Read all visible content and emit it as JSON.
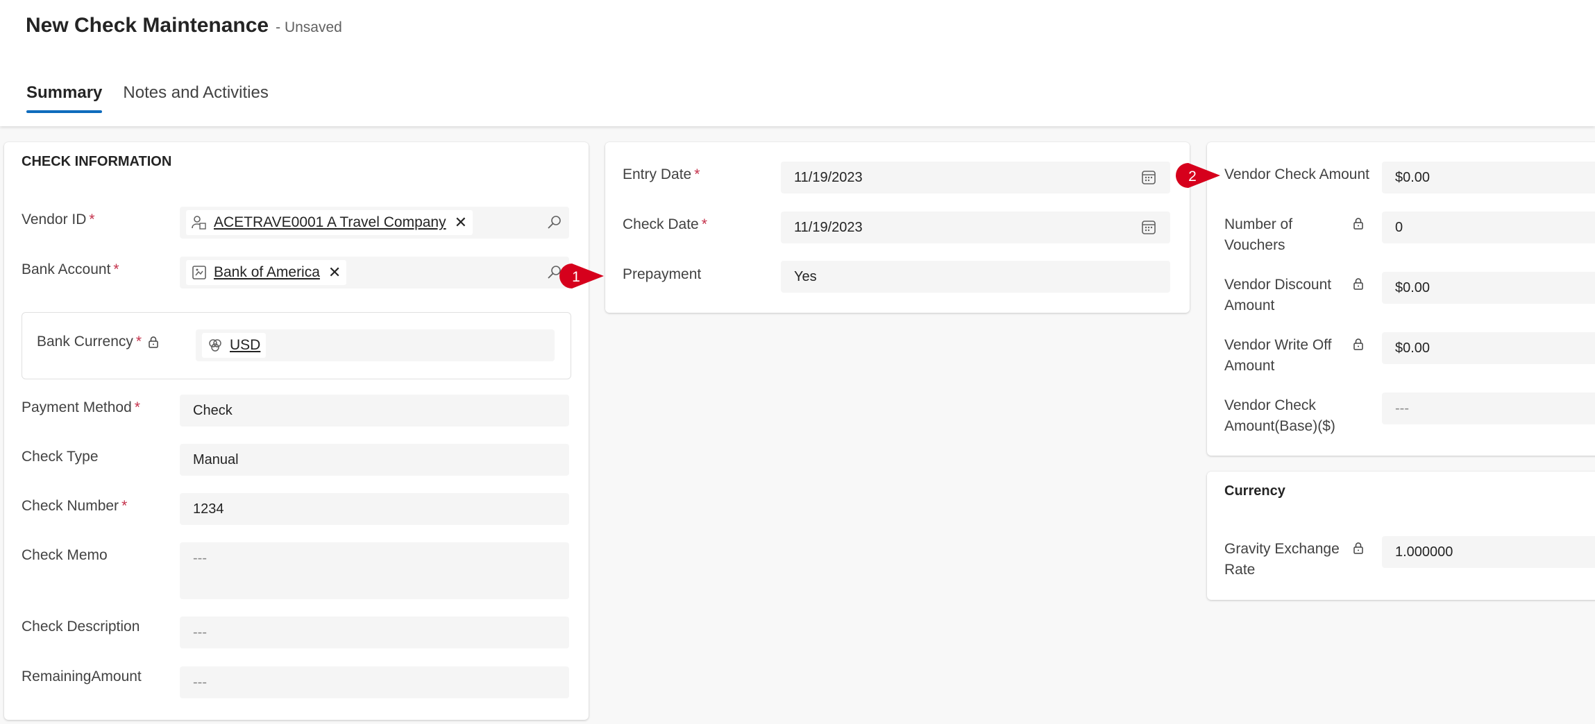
{
  "header": {
    "title": "New Check Maintenance",
    "status": "- Unsaved",
    "tabs": [
      {
        "label": "Summary",
        "active": true
      },
      {
        "label": "Notes and Activities",
        "active": false
      }
    ]
  },
  "check_info": {
    "section_title": "CHECK INFORMATION",
    "vendor_id": {
      "label": "Vendor ID",
      "value": "ACETRAVE0001 A Travel Company",
      "icon": "vendor-icon"
    },
    "bank_account": {
      "label": "Bank Account",
      "value": "Bank of America",
      "icon": "bank-icon"
    },
    "bank_currency": {
      "label": "Bank Currency",
      "value": "USD",
      "icon": "currency-icon",
      "locked": true
    },
    "payment_method": {
      "label": "Payment Method",
      "value": "Check"
    },
    "check_type": {
      "label": "Check Type",
      "value": "Manual"
    },
    "check_number": {
      "label": "Check Number",
      "value": "1234"
    },
    "check_memo": {
      "label": "Check Memo",
      "value": "---"
    },
    "check_description": {
      "label": "Check Description",
      "value": "---"
    },
    "remaining_amount": {
      "label": "RemainingAmount",
      "value": "---"
    }
  },
  "dates": {
    "entry_date": {
      "label": "Entry Date",
      "value": "11/19/2023"
    },
    "check_date": {
      "label": "Check Date",
      "value": "11/19/2023"
    },
    "prepayment": {
      "label": "Prepayment",
      "value": "Yes"
    }
  },
  "amounts": {
    "vendor_check_amount": {
      "label": "Vendor Check Amount",
      "value": "$0.00"
    },
    "number_of_vouchers": {
      "label_line1": "Number of",
      "label_line2": "Vouchers",
      "value": "0"
    },
    "vendor_discount_amount": {
      "label_line1": "Vendor Discount",
      "label_line2": "Amount",
      "value": "$0.00"
    },
    "vendor_write_off_amount": {
      "label_line1": "Vendor Write Off",
      "label_line2": "Amount",
      "value": "$0.00"
    },
    "vendor_check_amount_base": {
      "label_line1": "Vendor Check",
      "label_line2": "Amount(Base)($)",
      "value": "---"
    }
  },
  "currency": {
    "section_title": "Currency",
    "exchange_rate": {
      "label_line1": "Gravity Exchange",
      "label_line2": "Rate",
      "value": "1.000000"
    }
  },
  "markers": [
    {
      "number": "1"
    },
    {
      "number": "2"
    }
  ],
  "colors": {
    "accent": "#0f6cbd",
    "required": "#c4314b",
    "marker": "#d6001c"
  }
}
